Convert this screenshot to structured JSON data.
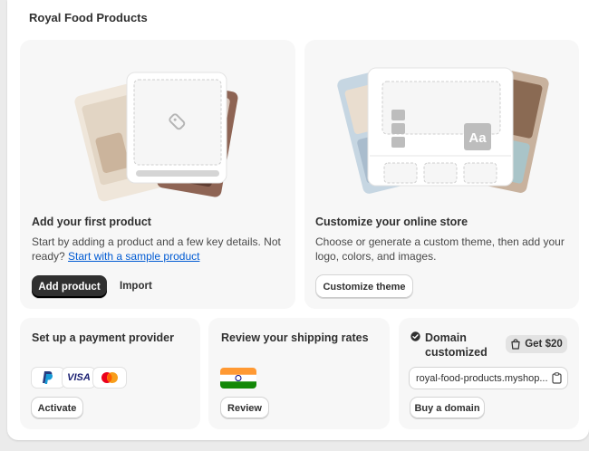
{
  "app": {
    "title": "Royal Food Products"
  },
  "product_card": {
    "title": "Add your first product",
    "description": "Start by adding a product and a few key details. Not ready?",
    "sample_link": "Start with a sample product",
    "primary_button": "Add product",
    "secondary_button": "Import"
  },
  "theme_card": {
    "title": "Customize your online store",
    "description_line1": "Choose or generate a custom theme, then add your",
    "description_line2": "logo, colors, and images.",
    "button": "Customize theme",
    "illustration_text": "Aa"
  },
  "payment_card": {
    "title": "Set up a payment provider",
    "providers": [
      "paypal-icon",
      "visa-icon",
      "mastercard-icon"
    ],
    "visa_label": "VISA",
    "button": "Activate"
  },
  "shipping_card": {
    "title": "Review your shipping rates",
    "flag": "india-flag-icon",
    "button": "Review"
  },
  "domain_card": {
    "title_line1": "Domain",
    "title_line2": "customized",
    "badge": "Get $20",
    "domain_value": "royal-food-products.myshop...",
    "button": "Buy a domain"
  },
  "colors": {
    "primary_button": "#303030",
    "link": "#005bd3",
    "card_bg": "#f7f7f7",
    "page_bg": "#ebebeb"
  }
}
